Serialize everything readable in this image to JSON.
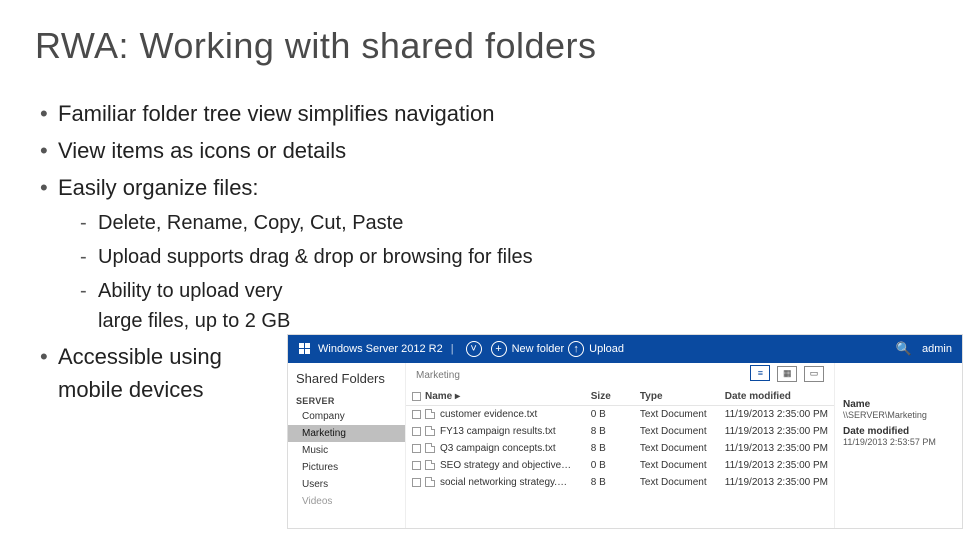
{
  "slide": {
    "title": "RWA: Working with shared folders",
    "bullets": [
      "Familiar folder tree view simplifies navigation",
      "View items as icons or details",
      "Easily organize files:"
    ],
    "subs": [
      "Delete, Rename, Copy, Cut, Paste",
      "Upload supports drag & drop or browsing for files",
      "Ability to upload very large files, up to 2 GB"
    ],
    "bullet4": "Accessible using mobile devices"
  },
  "app": {
    "brand": "Windows Server 2012 R2",
    "new_folder": "New folder",
    "upload": "Upload",
    "user": "admin",
    "left": {
      "heading": "Shared Folders",
      "group": "SERVER",
      "items": [
        "Company",
        "Marketing",
        "Music",
        "Pictures",
        "Users",
        "Videos"
      ],
      "selected_index": 1
    },
    "breadcrumb": "Marketing",
    "columns": {
      "name": "Name ▸",
      "size": "Size",
      "type": "Type",
      "modified": "Date modified"
    },
    "rows": [
      {
        "name": "customer evidence.txt",
        "size": "0 B",
        "type": "Text Document",
        "modified": "11/19/2013 2:35:00 PM"
      },
      {
        "name": "FY13 campaign results.txt",
        "size": "8 B",
        "type": "Text Document",
        "modified": "11/19/2013 2:35:00 PM"
      },
      {
        "name": "Q3 campaign concepts.txt",
        "size": "8 B",
        "type": "Text Document",
        "modified": "11/19/2013 2:35:00 PM"
      },
      {
        "name": "SEO strategy and objective…",
        "size": "0 B",
        "type": "Text Document",
        "modified": "11/19/2013 2:35:00 PM"
      },
      {
        "name": "social networking strategy.…",
        "size": "8 B",
        "type": "Text Document",
        "modified": "11/19/2013 2:35:00 PM"
      }
    ],
    "meta": {
      "name_h": "Name",
      "name_v": "\\\\SERVER\\Marketing",
      "date_h": "Date modified",
      "date_v": "11/19/2013 2:53:57 PM"
    }
  }
}
